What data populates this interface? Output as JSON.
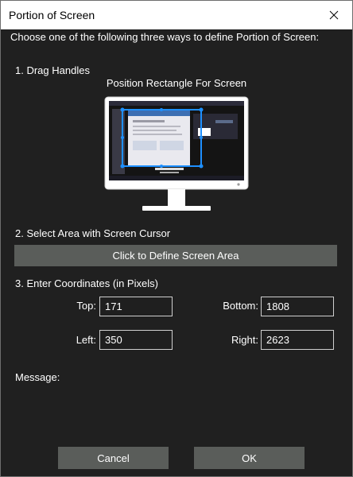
{
  "window": {
    "title": "Portion of Screen"
  },
  "intro_text": "Choose one of the following three ways to define Portion of Screen:",
  "section1": {
    "heading": "1. Drag Handles",
    "caption": "Position Rectangle For Screen"
  },
  "section2": {
    "heading": "2. Select Area with Screen Cursor",
    "define_button_label": "Click to Define Screen Area"
  },
  "section3": {
    "heading": "3. Enter Coordinates (in Pixels)",
    "top_label": "Top:",
    "top_value": "171",
    "bottom_label": "Bottom:",
    "bottom_value": "1808",
    "left_label": "Left:",
    "left_value": "350",
    "right_label": "Right:",
    "right_value": "2623"
  },
  "message": {
    "label": "Message:"
  },
  "footer": {
    "cancel_label": "Cancel",
    "ok_label": "OK"
  },
  "colors": {
    "background": "#202020",
    "button": "#5a5d5a",
    "selection": "#1e90ff"
  },
  "icons": {
    "close": "close-icon",
    "monitor": "monitor-icon"
  }
}
